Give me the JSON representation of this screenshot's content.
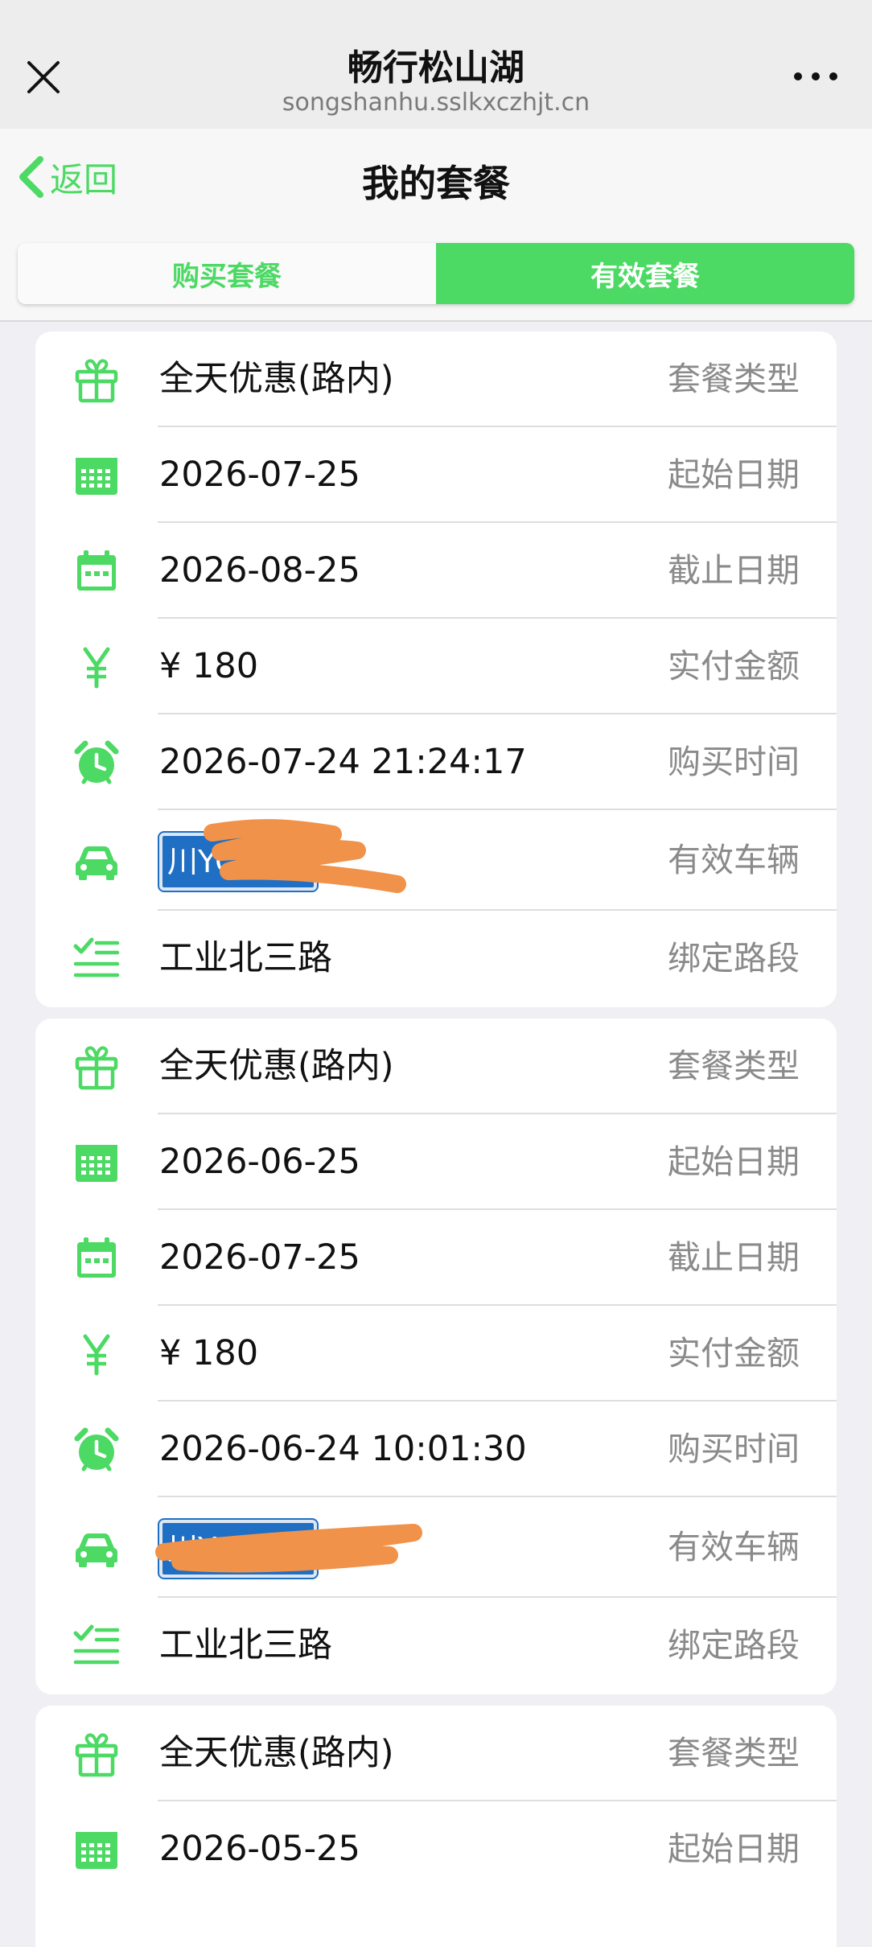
{
  "wechat_bar": {
    "title": "畅行松山湖",
    "url": "songshanhu.sslkxczhjt.cn"
  },
  "nav": {
    "back_label": "返回",
    "page_title": "我的套餐"
  },
  "tabs": [
    {
      "label": "购买套餐",
      "active": false
    },
    {
      "label": "有效套餐",
      "active": true
    }
  ],
  "colors": {
    "accent_green": "#4cd964",
    "plate_blue": "#1f6fc4",
    "redaction_orange": "#f0924a"
  },
  "packages": [
    {
      "type": "全天优惠(路内)",
      "type_label": "套餐类型",
      "start_date": "2026-07-25",
      "start_label": "起始日期",
      "end_date": "2026-08-25",
      "end_label": "截止日期",
      "amount": "¥ 180",
      "amount_label": "实付金额",
      "purchase_time": "2026-07-24 21:24:17",
      "purchase_label": "购买时间",
      "plate": "川YC",
      "vehicle_label": "有效车辆",
      "road": "工业北三路",
      "road_label": "绑定路段"
    },
    {
      "type": "全天优惠(路内)",
      "type_label": "套餐类型",
      "start_date": "2026-06-25",
      "start_label": "起始日期",
      "end_date": "2026-07-25",
      "end_label": "截止日期",
      "amount": "¥ 180",
      "amount_label": "实付金额",
      "purchase_time": "2026-06-24 10:01:30",
      "purchase_label": "购买时间",
      "plate": "川Y",
      "vehicle_label": "有效车辆",
      "road": "工业北三路",
      "road_label": "绑定路段"
    },
    {
      "type": "全天优惠(路内)",
      "type_label": "套餐类型",
      "start_date": "2026-05-25",
      "start_label": "起始日期"
    }
  ],
  "icons": [
    "close-icon",
    "more-icon",
    "chevron-left-icon",
    "gift-icon",
    "calendar-grid-icon",
    "calendar-icon",
    "yen-icon",
    "alarm-clock-icon",
    "car-icon",
    "checklist-icon"
  ]
}
